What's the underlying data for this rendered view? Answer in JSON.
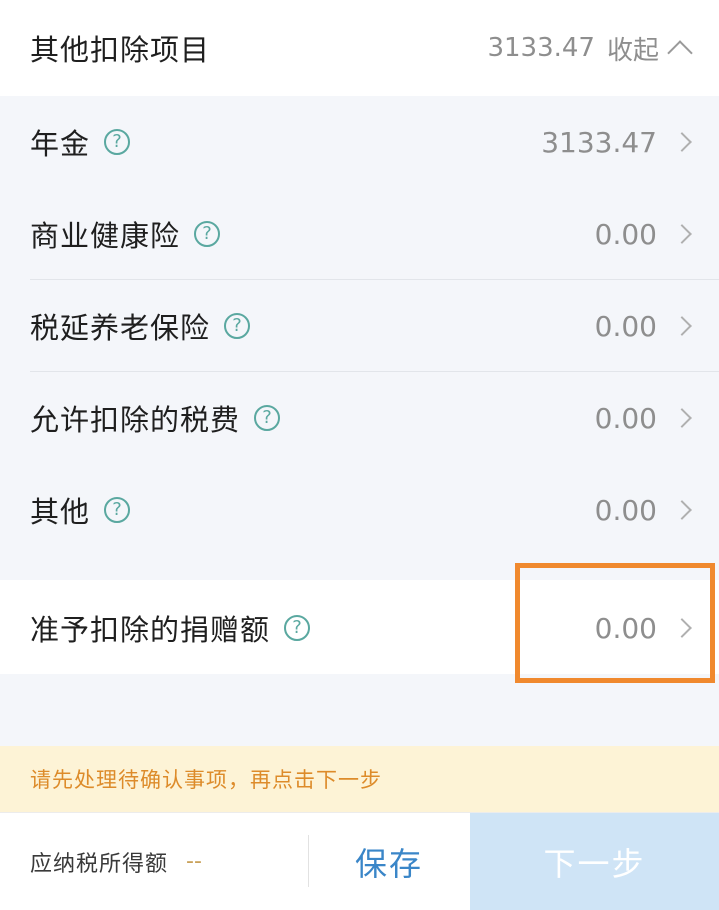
{
  "header": {
    "title": "其他扣除项目",
    "total": "3133.47",
    "collapse_label": "收起"
  },
  "items": [
    {
      "label": "年金",
      "value": "3133.47"
    },
    {
      "label": "商业健康险",
      "value": "0.00"
    },
    {
      "label": "税延养老保险",
      "value": "0.00"
    },
    {
      "label": "允许扣除的税费",
      "value": "0.00"
    },
    {
      "label": "其他",
      "value": "0.00"
    }
  ],
  "donation": {
    "label": "准予扣除的捐赠额",
    "value": "0.00"
  },
  "help_glyph": "?",
  "notice": "请先处理待确认事项，再点击下一步",
  "bottom_bar": {
    "taxable_label": "应纳税所得额",
    "taxable_value": "--",
    "save_label": "保存",
    "next_label": "下一步"
  },
  "colors": {
    "highlight": "#f0892e",
    "help_icon": "#5aa8a0",
    "save_text": "#3a86c8",
    "next_bg": "#cfe4f6",
    "notice_bg": "#fdf3d6",
    "notice_text": "#dd8b2a"
  },
  "icons": [
    "chevron-up-icon",
    "chevron-right-icon",
    "help-circle-icon"
  ]
}
